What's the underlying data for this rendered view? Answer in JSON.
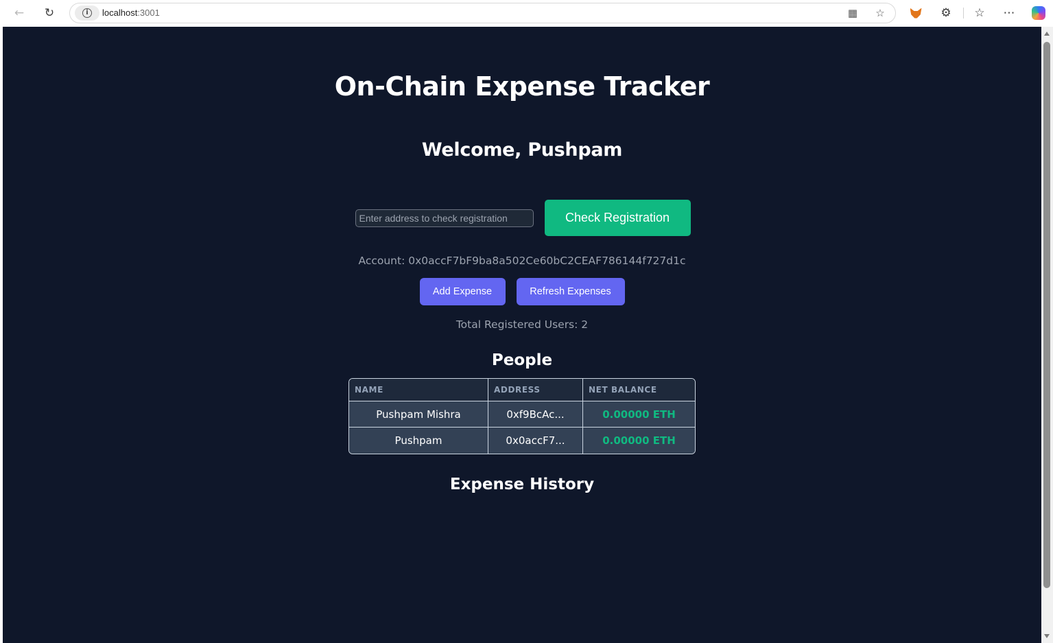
{
  "browser": {
    "url_host": "localhost",
    "url_port": ":3001"
  },
  "app": {
    "title": "On-Chain Expense Tracker",
    "welcome": "Welcome, Pushpam",
    "address_placeholder": "Enter address to check registration",
    "check_button": "Check Registration",
    "account_text": "Account: 0x0accF7bF9ba8a502Ce60bC2CEAF786144f727d1c",
    "add_expense_button": "Add Expense",
    "refresh_button": "Refresh Expenses",
    "total_users_text": "Total Registered Users: 2",
    "people_title": "People",
    "people_table": {
      "headers": [
        "NAME",
        "ADDRESS",
        "NET BALANCE"
      ],
      "rows": [
        {
          "name": "Pushpam Mishra",
          "address": "0xf9BcAc...",
          "balance": "0.00000 ETH"
        },
        {
          "name": "Pushpam",
          "address": "0x0accF7...",
          "balance": "0.00000 ETH"
        }
      ]
    },
    "history_title": "Expense History"
  },
  "colors": {
    "page_background": "#0f172a",
    "success": "#10b981",
    "accent": "#6366f1"
  }
}
